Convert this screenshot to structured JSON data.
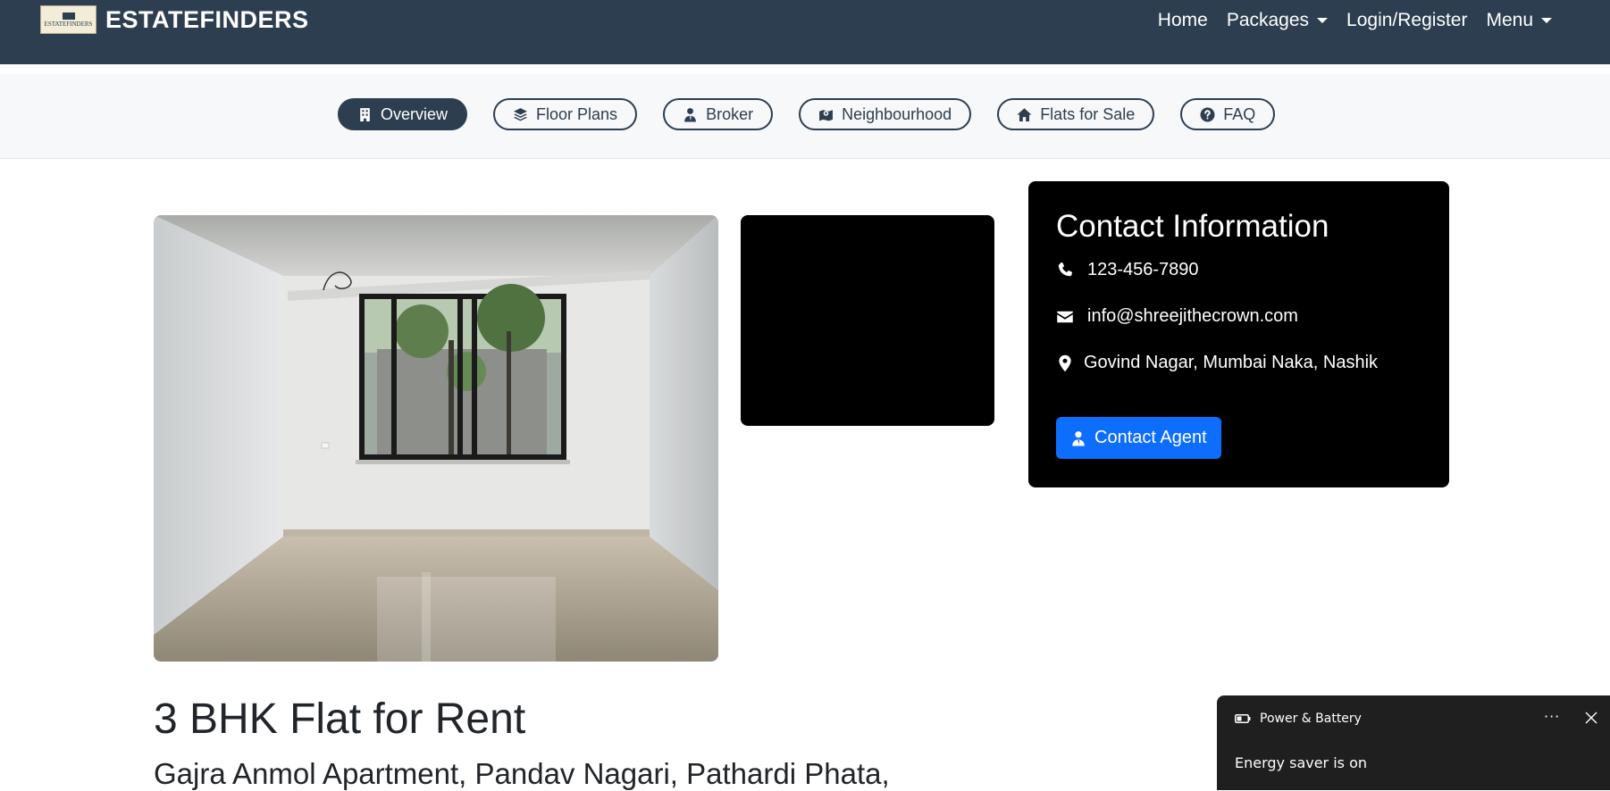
{
  "navbar": {
    "brand": "ESTATEFINDERS",
    "logo_text": "ESTATEFINDERS",
    "links": [
      {
        "label": "Home",
        "dropdown": false
      },
      {
        "label": "Packages",
        "dropdown": true
      },
      {
        "label": "Login/Register",
        "dropdown": false
      },
      {
        "label": "Menu",
        "dropdown": true
      }
    ],
    "background": "#2c3e50"
  },
  "tabs": [
    {
      "label": "Overview",
      "icon": "building-icon",
      "active": true
    },
    {
      "label": "Floor Plans",
      "icon": "layers-icon",
      "active": false
    },
    {
      "label": "Broker",
      "icon": "user-tie-icon",
      "active": false
    },
    {
      "label": "Neighbourhood",
      "icon": "map-location-icon",
      "active": false
    },
    {
      "label": "Flats for Sale",
      "icon": "home-icon",
      "active": false
    },
    {
      "label": "FAQ",
      "icon": "question-circle-icon",
      "active": false
    }
  ],
  "contact": {
    "title": "Contact Information",
    "phone": "123-456-7890",
    "email": "info@shreejithecrown.com",
    "address": "Govind Nagar, Mumbai Naka, Nashik",
    "button_label": "Contact Agent",
    "button_color": "#0d6efd"
  },
  "listing": {
    "title": "3 BHK Flat for Rent",
    "address": "Gajra Anmol Apartment, Pandav Nagari, Pathardi Phata,"
  },
  "toast": {
    "app": "Power & Battery",
    "more": "···",
    "message": "Energy saver is on"
  }
}
